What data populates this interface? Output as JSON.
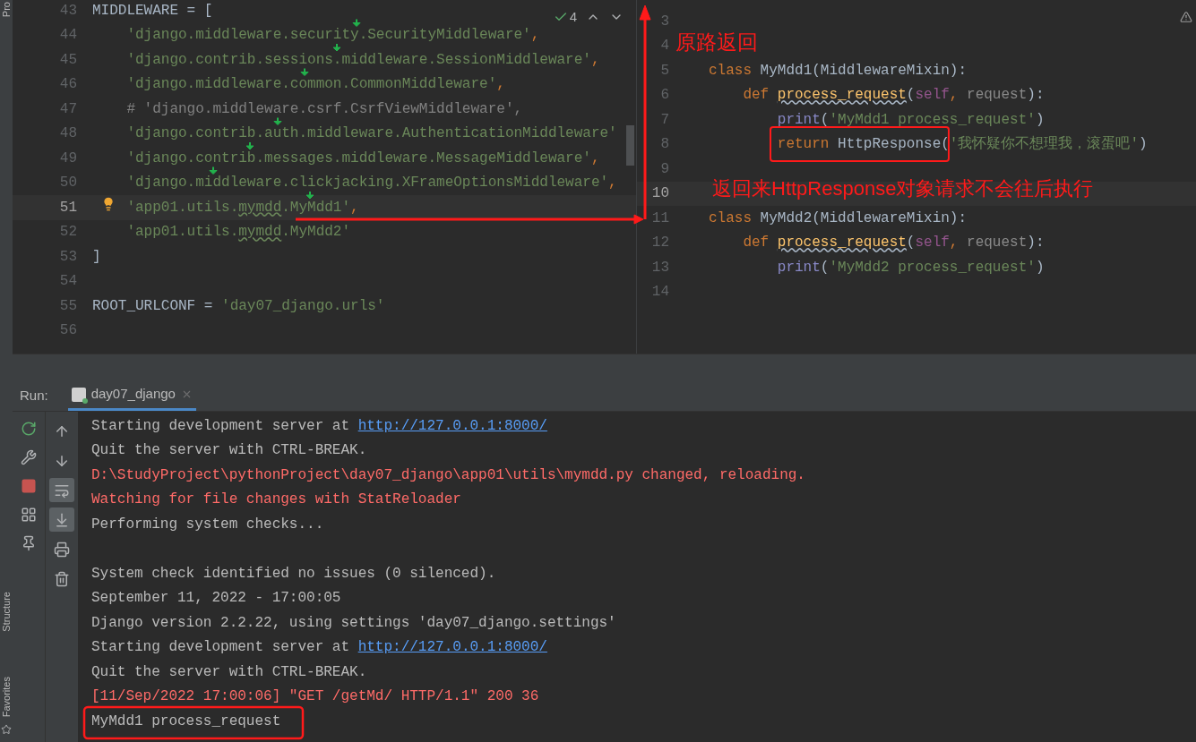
{
  "side_strip": {
    "labels": [
      "Pro",
      "Structure",
      "Favorites"
    ]
  },
  "left_editor": {
    "inspection_count": "4",
    "lines": [
      {
        "number": "43",
        "current": false,
        "code": [
          {
            "t": "MIDDLEWARE = [",
            "kind": "text"
          }
        ]
      },
      {
        "number": "44",
        "current": false,
        "code": [
          {
            "t": "    'django.middleware.security.SecurityMiddleware'",
            "kind": "string"
          },
          {
            "t": ",",
            "kind": "keyword"
          }
        ]
      },
      {
        "number": "45",
        "current": false,
        "code": [
          {
            "t": "    'django.contrib.sessions.middleware.SessionMiddleware'",
            "kind": "string"
          },
          {
            "t": ",",
            "kind": "keyword"
          }
        ]
      },
      {
        "number": "46",
        "current": false,
        "code": [
          {
            "t": "    'django.middleware.common.CommonMiddleware'",
            "kind": "string"
          },
          {
            "t": ",",
            "kind": "keyword"
          }
        ]
      },
      {
        "number": "47",
        "current": false,
        "code": [
          {
            "t": "    # 'django.middleware.csrf.CsrfViewMiddleware',",
            "kind": "comment"
          }
        ]
      },
      {
        "number": "48",
        "current": false,
        "code": [
          {
            "t": "    'django.contrib.auth.middleware.AuthenticationMiddleware'",
            "kind": "string"
          }
        ]
      },
      {
        "number": "49",
        "current": false,
        "code": [
          {
            "t": "    'django.contrib.messages.middleware.MessageMiddleware'",
            "kind": "string"
          },
          {
            "t": ",",
            "kind": "keyword"
          }
        ]
      },
      {
        "number": "50",
        "current": false,
        "code": [
          {
            "t": "    'django.middleware.clickjacking.XFrameOptionsMiddleware'",
            "kind": "string"
          },
          {
            "t": ",",
            "kind": "keyword"
          }
        ]
      },
      {
        "number": "51",
        "current": true,
        "code": [
          {
            "t": "    'app01.utils.",
            "kind": "string"
          },
          {
            "t": "mymdd",
            "kind": "string_warn"
          },
          {
            "t": ".MyMdd1'",
            "kind": "string"
          },
          {
            "t": ",",
            "kind": "keyword"
          }
        ]
      },
      {
        "number": "52",
        "current": false,
        "code": [
          {
            "t": "    'app01.utils.",
            "kind": "string"
          },
          {
            "t": "mymdd",
            "kind": "string_warn"
          },
          {
            "t": ".MyMdd2'",
            "kind": "string"
          }
        ]
      },
      {
        "number": "53",
        "current": false,
        "code": [
          {
            "t": "]",
            "kind": "text"
          }
        ]
      },
      {
        "number": "54",
        "current": false
      },
      {
        "number": "55",
        "current": false,
        "code": [
          {
            "t": "ROOT_URLCONF = ",
            "kind": "text"
          },
          {
            "t": "'day07_django.urls'",
            "kind": "string"
          }
        ]
      },
      {
        "number": "56",
        "current": false
      }
    ]
  },
  "right_editor": {
    "lines": [
      {
        "number": "3",
        "current": false
      },
      {
        "number": "4",
        "current": false
      },
      {
        "number": "5",
        "current": false,
        "code": [
          {
            "t": "class",
            "kind": "keyword"
          },
          {
            "t": " MyMdd1(MiddlewareMixin):",
            "kind": "text"
          }
        ]
      },
      {
        "number": "6",
        "current": false,
        "code": [
          {
            "t": "    def ",
            "kind": "keyword"
          },
          {
            "t": "process_request",
            "kind": "fn_warn"
          },
          {
            "t": "(",
            "kind": "text"
          },
          {
            "t": "self",
            "kind": "self"
          },
          {
            "t": ", ",
            "kind": "keyword"
          },
          {
            "t": "request",
            "kind": "param"
          },
          {
            "t": "):",
            "kind": "text"
          }
        ]
      },
      {
        "number": "7",
        "current": false,
        "code": [
          {
            "t": "        print",
            "kind": "builtin"
          },
          {
            "t": "(",
            "kind": "text"
          },
          {
            "t": "'MyMdd1 process_request'",
            "kind": "string"
          },
          {
            "t": ")",
            "kind": "text"
          }
        ]
      },
      {
        "number": "8",
        "current": false,
        "code": [
          {
            "t": "        return",
            "kind": "keyword",
            "boxed": true
          },
          {
            "t": " HttpResponse(",
            "kind": "text",
            "boxed": true
          },
          {
            "t": "'我怀疑你不想理我，滚蛋吧'",
            "kind": "string",
            "boxed": false
          },
          {
            "t": ")",
            "kind": "text",
            "boxed": false
          }
        ]
      },
      {
        "number": "9",
        "current": false
      },
      {
        "number": "10",
        "current": true
      },
      {
        "number": "11",
        "current": false,
        "code": [
          {
            "t": "class",
            "kind": "keyword"
          },
          {
            "t": " MyMdd2(MiddlewareMixin):",
            "kind": "text"
          }
        ]
      },
      {
        "number": "12",
        "current": false,
        "code": [
          {
            "t": "    def ",
            "kind": "keyword"
          },
          {
            "t": "process_request",
            "kind": "fn_warn"
          },
          {
            "t": "(",
            "kind": "text"
          },
          {
            "t": "self",
            "kind": "self"
          },
          {
            "t": ", ",
            "kind": "keyword"
          },
          {
            "t": "request",
            "kind": "param"
          },
          {
            "t": "):",
            "kind": "text"
          }
        ]
      },
      {
        "number": "13",
        "current": false,
        "code": [
          {
            "t": "        print",
            "kind": "builtin"
          },
          {
            "t": "(",
            "kind": "text"
          },
          {
            "t": "'MyMdd2 process_request'",
            "kind": "string"
          },
          {
            "t": ")",
            "kind": "text"
          }
        ]
      },
      {
        "number": "14",
        "current": false
      }
    ]
  },
  "run_panel": {
    "label": "Run:",
    "tabs": [
      {
        "label": "day07_django",
        "selected": true
      }
    ],
    "toolbar_left": [
      {
        "on": false
      },
      {
        "on": false
      },
      {
        "on": false
      },
      {
        "on": false
      },
      {
        "on": false
      }
    ],
    "toolbar_right": [
      {
        "on": false
      },
      {
        "on": false
      },
      {
        "on": true
      },
      {
        "on": true
      },
      {
        "on": false
      },
      {
        "on": false
      }
    ],
    "console": [
      {
        "kind": "text",
        "segments": [
          {
            "t": "Starting development server at ",
            "kind": "normal"
          },
          {
            "t": "http://127.0.0.1:8000/",
            "kind": "link"
          }
        ]
      },
      {
        "kind": "text",
        "segments": [
          {
            "t": "Quit the server with CTRL-BREAK.",
            "kind": "normal"
          }
        ]
      },
      {
        "kind": "text",
        "segments": [
          {
            "t": "D:\\StudyProject\\pythonProject\\day07_django\\app01\\utils\\mymdd.py changed, reloading.",
            "kind": "error"
          }
        ]
      },
      {
        "kind": "text",
        "segments": [
          {
            "t": "Watching for file changes with StatReloader",
            "kind": "error"
          }
        ]
      },
      {
        "kind": "text",
        "segments": [
          {
            "t": "Performing system checks...",
            "kind": "normal"
          }
        ]
      },
      {
        "kind": "blank"
      },
      {
        "kind": "text",
        "segments": [
          {
            "t": "System check identified no issues (0 silenced).",
            "kind": "normal"
          }
        ]
      },
      {
        "kind": "text",
        "segments": [
          {
            "t": "September 11, 2022 - 17:00:05",
            "kind": "normal"
          }
        ]
      },
      {
        "kind": "text",
        "segments": [
          {
            "t": "Django version 2.2.22, using settings 'day07_django.settings'",
            "kind": "normal"
          }
        ]
      },
      {
        "kind": "text",
        "segments": [
          {
            "t": "Starting development server at ",
            "kind": "normal"
          },
          {
            "t": "http://127.0.0.1:8000/",
            "kind": "link"
          }
        ]
      },
      {
        "kind": "text",
        "segments": [
          {
            "t": "Quit the server with CTRL-BREAK.",
            "kind": "normal"
          }
        ]
      },
      {
        "kind": "text",
        "segments": [
          {
            "t": "[11/Sep/2022 17:00:06] \"GET /getMd/ HTTP/1.1\" 200 36",
            "kind": "error"
          }
        ]
      },
      {
        "kind": "text",
        "segments": [
          {
            "t": "MyMdd1 process_request",
            "kind": "normal"
          }
        ]
      }
    ]
  },
  "annotations": [
    {
      "text": "原路返回"
    },
    {
      "text": "返回来HttpResponse对象请求不会往后执行"
    }
  ]
}
